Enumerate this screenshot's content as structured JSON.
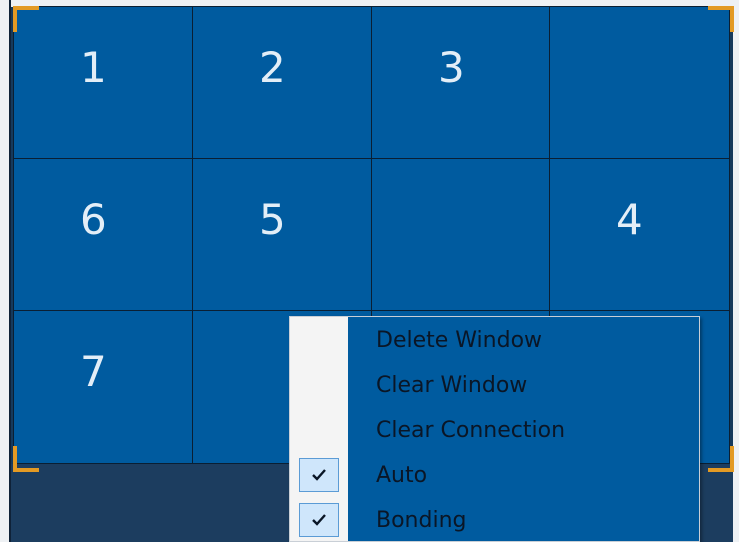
{
  "grid": {
    "cells": [
      {
        "label": "1"
      },
      {
        "label": "2"
      },
      {
        "label": "3"
      },
      {
        "label": ""
      },
      {
        "label": "6"
      },
      {
        "label": "5"
      },
      {
        "label": ""
      },
      {
        "label": "4"
      },
      {
        "label": "7"
      },
      {
        "label": ""
      },
      {
        "label": ""
      },
      {
        "label": ""
      }
    ]
  },
  "context_menu": {
    "items": [
      {
        "label": "Delete Window",
        "checked": false
      },
      {
        "label": "Clear Window",
        "checked": false
      },
      {
        "label": "Clear Connection",
        "checked": false
      },
      {
        "label": "Auto",
        "checked": true
      },
      {
        "label": "Bonding",
        "checked": true
      }
    ]
  },
  "colors": {
    "cell_blue": "#005b9f",
    "grid_line": "#0a1f33",
    "corner_marker": "#e39a24",
    "menu_gutter": "#f4f4f4",
    "check_highlight": "#cfe6fb"
  },
  "icons": {
    "check": "check-icon"
  }
}
